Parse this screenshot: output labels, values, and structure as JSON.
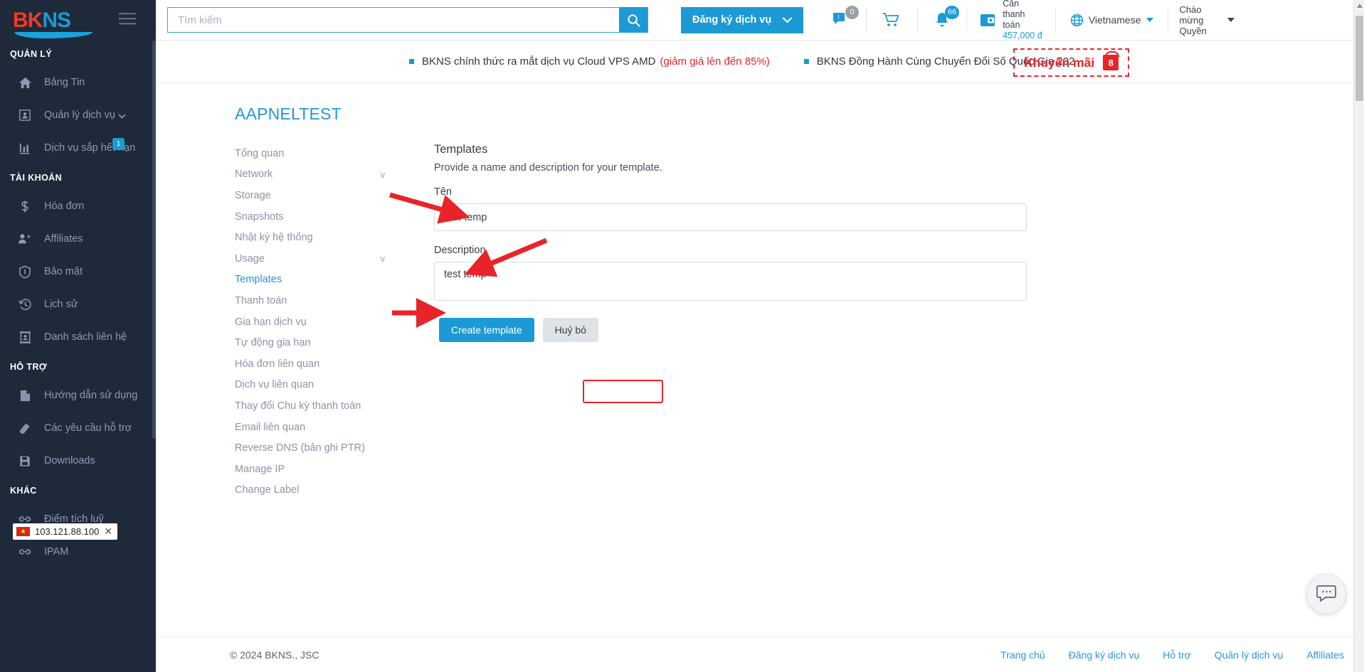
{
  "sidebar": {
    "logo": {
      "part1": "BK",
      "part2": "NS"
    },
    "sections": [
      {
        "title": "QUẢN LÝ",
        "items": [
          {
            "label": "Bảng Tin",
            "icon": "home-icon",
            "badge": null,
            "chevron": false
          },
          {
            "label": "Quản lý dịch vụ",
            "icon": "service-card-icon",
            "badge": null,
            "chevron": true
          },
          {
            "label": "Dịch vụ sắp hết hạn",
            "icon": "bar-chart-icon",
            "badge": "1",
            "chevron": false
          }
        ]
      },
      {
        "title": "TÀI KHOẢN",
        "items": [
          {
            "label": "Hóa đơn",
            "icon": "dollar-icon",
            "badge": null,
            "chevron": false
          },
          {
            "label": "Affiliates",
            "icon": "user-add-icon",
            "badge": null,
            "chevron": false
          },
          {
            "label": "Bảo mật",
            "icon": "shield-icon",
            "badge": null,
            "chevron": false
          },
          {
            "label": "Lịch sử",
            "icon": "history-icon",
            "badge": null,
            "chevron": false
          },
          {
            "label": "Danh sách liên hệ",
            "icon": "contact-card-icon",
            "badge": null,
            "chevron": false
          }
        ]
      },
      {
        "title": "HỖ TRỢ",
        "items": [
          {
            "label": "Hướng dẫn sử dụng",
            "icon": "document-icon",
            "badge": null,
            "chevron": false
          },
          {
            "label": "Các yêu cầu hỗ trợ",
            "icon": "ticket-icon",
            "badge": null,
            "chevron": false
          },
          {
            "label": "Downloads",
            "icon": "save-disk-icon",
            "badge": null,
            "chevron": false
          }
        ]
      },
      {
        "title": "KHÁC",
        "items": [
          {
            "label": "Điểm tích luỹ",
            "icon": "link-icon",
            "badge": null,
            "chevron": false
          },
          {
            "label": "IPAM",
            "icon": "link-icon",
            "badge": null,
            "chevron": false
          }
        ]
      }
    ],
    "ip_chip": {
      "flag": "vn-flag-icon",
      "ip": "103.121.88.100",
      "close": "✕"
    }
  },
  "header": {
    "menu_toggle_icon": "hamburger-icon",
    "search": {
      "placeholder": "Tìm kiếm",
      "value": "",
      "button_icon": "search-icon"
    },
    "register_button": {
      "label": "Đăng ký dịch vụ",
      "caret": "chevron-down-icon"
    },
    "support_icon": {
      "name": "support-chat-icon",
      "count": "0"
    },
    "cart_icon": {
      "name": "cart-icon"
    },
    "bell_icon": {
      "name": "bell-icon",
      "count": "66"
    },
    "payment": {
      "icon": "wallet-icon",
      "label": "Cần thanh toán",
      "amount": "457,000 đ"
    },
    "language": {
      "icon": "globe-icon",
      "label": "Vietnamese",
      "caret": "chevron-down-icon"
    },
    "greeting": {
      "label": "Chào mừng Quyền",
      "caret": "chevron-down-icon"
    }
  },
  "announce": {
    "items": [
      {
        "text": "BKNS chính thức ra mắt dịch vụ Cloud VPS AMD",
        "highlight": "(giảm giá lên đến 85%)"
      },
      {
        "text": "BKNS Đồng Hành Cùng Chuyển Đổi Số Quốc Gia 202",
        "highlight": ""
      }
    ],
    "promo": {
      "label": "Khuyến mãi",
      "badge": "8",
      "icon": "gift-icon"
    }
  },
  "main": {
    "page_title": "AAPNELTEST",
    "submenu": [
      {
        "label": "Tổng quan",
        "active": false,
        "chevron": ""
      },
      {
        "label": "Network",
        "active": false,
        "chevron": "v"
      },
      {
        "label": "Storage",
        "active": false,
        "chevron": ""
      },
      {
        "label": "Snapshots",
        "active": false,
        "chevron": ""
      },
      {
        "label": "Nhật ký hệ thống",
        "active": false,
        "chevron": ""
      },
      {
        "label": "Usage",
        "active": false,
        "chevron": "v"
      },
      {
        "label": "Templates",
        "active": true,
        "chevron": ""
      },
      {
        "label": "Thanh toán",
        "active": false,
        "chevron": ""
      },
      {
        "label": "Gia hạn dịch vụ",
        "active": false,
        "chevron": ""
      },
      {
        "label": "Tự động gia hạn",
        "active": false,
        "chevron": ""
      },
      {
        "label": "Hóa đơn liên quan",
        "active": false,
        "chevron": ""
      },
      {
        "label": "Dịch vụ liên quan",
        "active": false,
        "chevron": ""
      },
      {
        "label": "Thay đổi Chu kỳ thanh toán",
        "active": false,
        "chevron": ""
      },
      {
        "label": "Email liên quan",
        "active": false,
        "chevron": ""
      },
      {
        "label": "Reverse DNS (bản ghi PTR)",
        "active": false,
        "chevron": ""
      },
      {
        "label": "Manage IP",
        "active": false,
        "chevron": ""
      },
      {
        "label": "Change Label",
        "active": false,
        "chevron": ""
      }
    ],
    "form": {
      "heading": "Templates",
      "subheading": "Provide a name and description for your template.",
      "name_label": "Tên",
      "name_value": "test-temp",
      "name_placeholder": "",
      "desc_label": "Description",
      "desc_value": "test temp",
      "desc_placeholder": "",
      "create_button": "Create template",
      "cancel_button": "Huỷ bỏ"
    }
  },
  "footer": {
    "copyright": "© 2024 BKNS., JSC",
    "links": [
      "Trang chủ",
      "Đăng ký dịch vụ",
      "Hỗ trợ",
      "Quản lý dịch vụ",
      "Affiliates"
    ]
  },
  "chat": {
    "icon": "chat-bubble-icon"
  },
  "colors": {
    "brand_blue": "#1c9ad6",
    "brand_red": "#ef3b24",
    "sidebar_bg": "#1e2a3a",
    "accent_red": "#e8242a"
  }
}
